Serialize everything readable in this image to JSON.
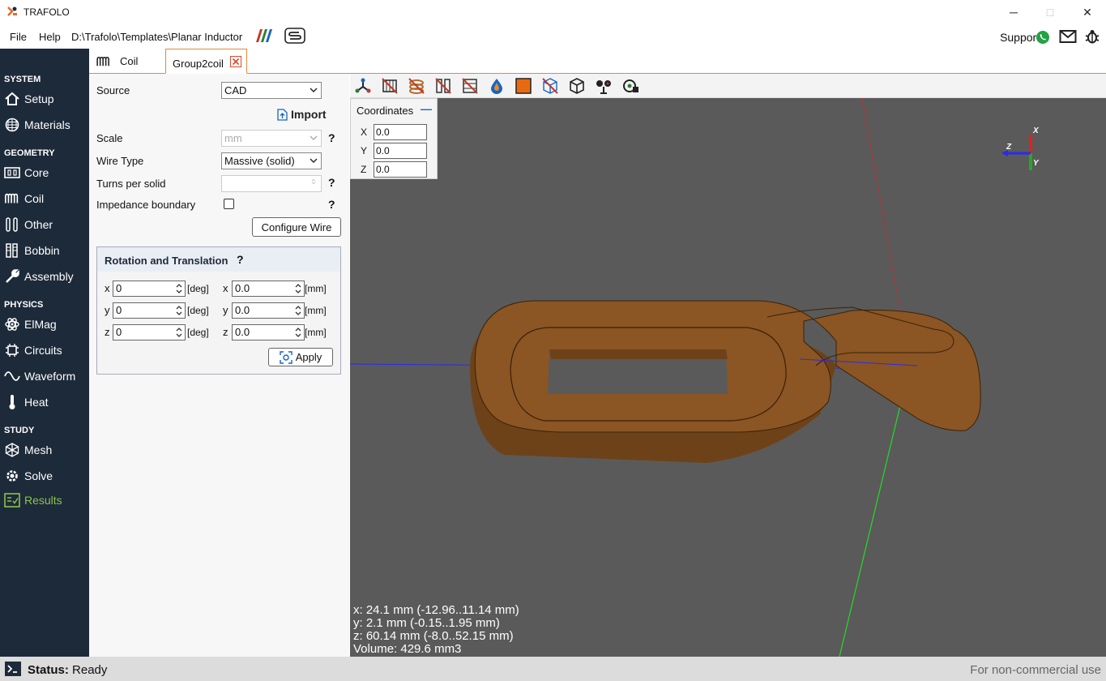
{
  "window": {
    "title": "TRAFOLO",
    "minimize": "─",
    "maximize": "□",
    "close": "✕"
  },
  "menu": {
    "file": "File",
    "help": "Help",
    "path": "D:\\Trafolo\\Templates\\Planar Inductor",
    "support": "Support:"
  },
  "sidebar": {
    "system": "SYSTEM",
    "setup": "Setup",
    "materials": "Materials",
    "geometry": "GEOMETRY",
    "core": "Core",
    "coil": "Coil",
    "other": "Other",
    "bobbin": "Bobbin",
    "assembly": "Assembly",
    "physics": "PHYSICS",
    "elmag": "ElMag",
    "circuits": "Circuits",
    "waveform": "Waveform",
    "heat": "Heat",
    "study": "STUDY",
    "mesh": "Mesh",
    "solve": "Solve",
    "results": "Results"
  },
  "tabs": {
    "coil": "Coil",
    "group2coil": "Group2coil"
  },
  "form": {
    "source_label": "Source",
    "source_value": "CAD",
    "import": "Import",
    "scale_label": "Scale",
    "scale_value": "mm",
    "wire_label": "Wire Type",
    "wire_value": "Massive (solid)",
    "turns_label": "Turns per solid",
    "turns_value": "",
    "impedance_label": "Impedance boundary",
    "configure_wire": "Configure Wire",
    "q": "?"
  },
  "rt": {
    "title": "Rotation and Translation",
    "rx": "0",
    "ry": "0",
    "rz": "0",
    "tx": "0.0",
    "ty": "0.0",
    "tz": "0.0",
    "deg": "[deg]",
    "mm": "[mm]",
    "x": "x",
    "y": "y",
    "z": "z",
    "apply": "Apply"
  },
  "coordinates": {
    "title": "Coordinates",
    "X": "X",
    "Y": "Y",
    "Z": "Z",
    "xv": "0.0",
    "yv": "0.0",
    "zv": "0.0",
    "collapse": "—"
  },
  "axes": {
    "x": "X",
    "y": "Y",
    "z": "Z"
  },
  "info": {
    "x": "x: 24.1 mm (-12.96..11.14 mm)",
    "y": "y: 2.1 mm (-0.15..1.95 mm)",
    "z": "z: 60.14 mm (-8.0..52.15 mm)",
    "volume": "Volume: 429.6 mm3"
  },
  "status": {
    "label": "Status:",
    "value": "Ready",
    "license": "For non-commercial use"
  },
  "colors": {
    "sidebar": "#1d2a3a",
    "accent": "#e08a3a",
    "active": "#8bc34a",
    "copper": "#8b5524",
    "viewport": "#5a5a5a"
  }
}
